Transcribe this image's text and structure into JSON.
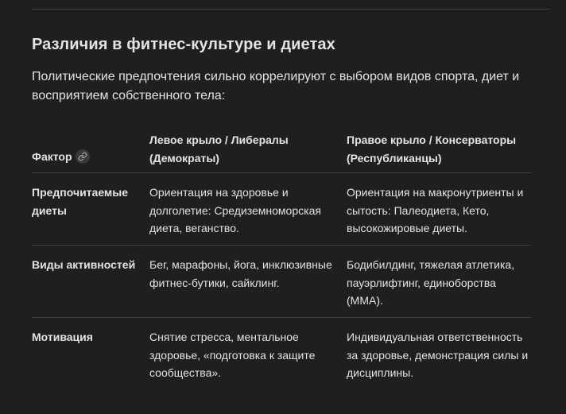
{
  "section": {
    "title": "Различия в фитнес-культуре и диетах",
    "intro": "Политические предпочтения сильно коррелируют с выбором видов спорта, диет и восприятием собственного тела:"
  },
  "table": {
    "headers": {
      "factor": "Фактор",
      "left": "Левое крыло / Либералы (Демократы)",
      "right": "Правое крыло / Консерваторы (Республиканцы)"
    },
    "rows": [
      {
        "factor": "Предпочитаемые диеты",
        "left": "Ориентация на здоровье и долголетие: Средиземноморская диета, веганство.",
        "right": "Ориентация на макронутриенты и сытость: Палеодиета, Кето, высокожировые диеты."
      },
      {
        "factor": "Виды активностей",
        "left": "Бег, марафоны, йога, инклюзивные фитнес-бутики, сайклинг.",
        "right": "Бодибилдинг, тяжелая атлетика, пауэрлифтинг, единоборства (MMA)."
      },
      {
        "factor": "Мотивация",
        "left": "Снятие стресса, ментальное здоровье, «подготовка к защите сообщества».",
        "right": "Индивидуальная ответственность за здоровье, демонстрация силы и дисциплины."
      }
    ]
  },
  "icons": {
    "header_link": "link-icon"
  },
  "colors": {
    "background": "#1f1f1f",
    "text": "#e3e3e3",
    "divider": "#3f3f3f"
  }
}
